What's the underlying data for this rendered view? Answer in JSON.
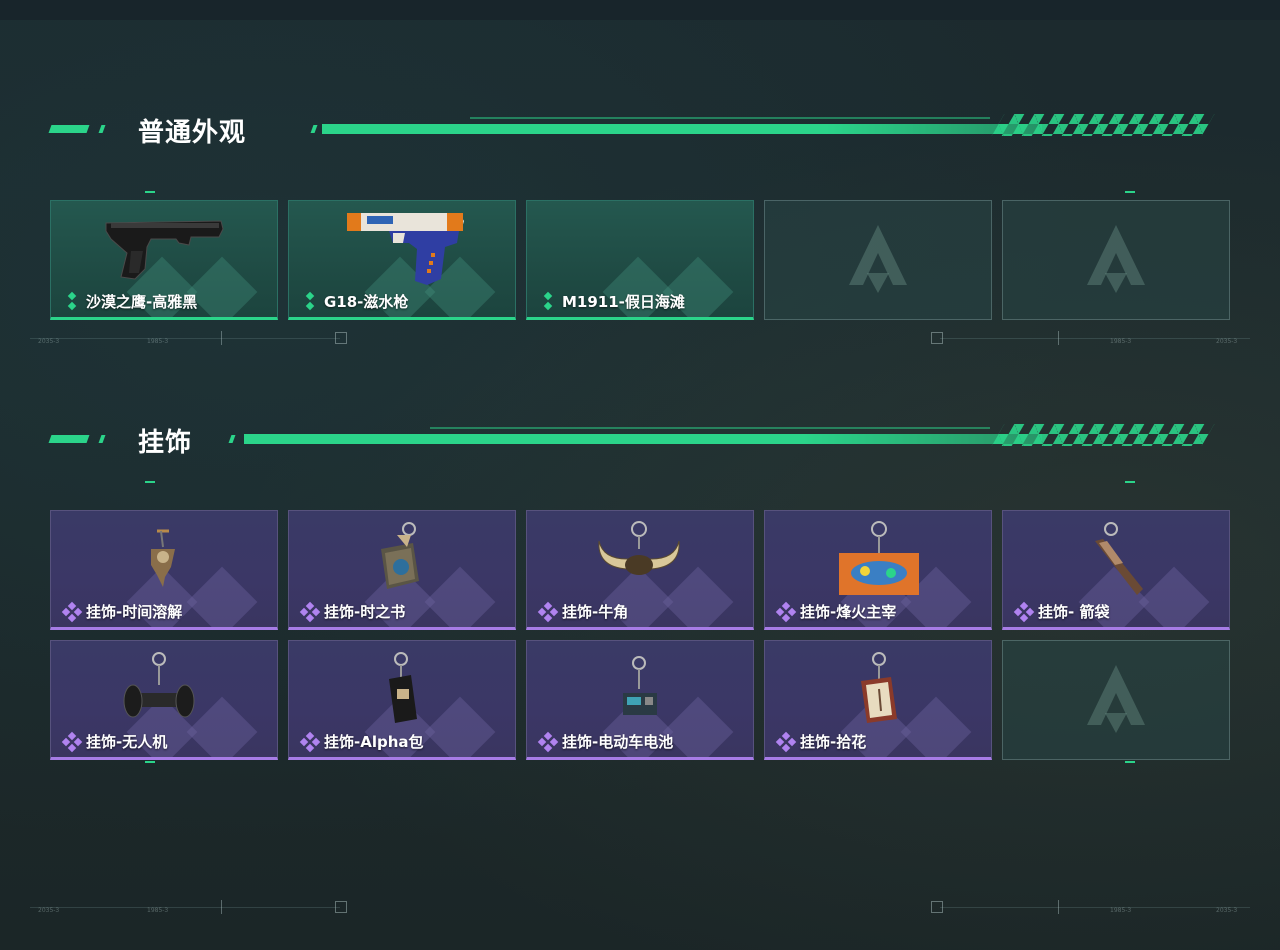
{
  "sections": {
    "skins": {
      "title": "普通外观",
      "items": [
        {
          "label": "沙漠之鹰-高雅黑",
          "icon": "pistol-black-icon"
        },
        {
          "label": "G18-滋水枪",
          "icon": "water-pistol-icon"
        },
        {
          "label": "M1911-假日海滩",
          "icon": ""
        }
      ]
    },
    "charms": {
      "title": "挂饰",
      "items": [
        {
          "label": "挂饰-时间溶解",
          "icon": "melting-clock-charm-icon"
        },
        {
          "label": "挂饰-时之书",
          "icon": "book-charm-icon"
        },
        {
          "label": "挂饰-牛角",
          "icon": "bull-horn-charm-icon"
        },
        {
          "label": "挂饰-烽火主宰",
          "icon": "banner-charm-icon"
        },
        {
          "label": "挂饰- 箭袋",
          "icon": "quiver-charm-icon"
        },
        {
          "label": "挂饰-无人机",
          "icon": "drone-charm-icon"
        },
        {
          "label": "挂饰-Alpha包",
          "icon": "alpha-bag-charm-icon"
        },
        {
          "label": "挂饰-电动车电池",
          "icon": "battery-charm-icon"
        },
        {
          "label": "挂饰-拾花",
          "icon": "flower-frame-charm-icon"
        }
      ]
    }
  },
  "guide_labels": {
    "left_top": "2035-3",
    "left_mid": "1985-3",
    "right_mid": "1985-3",
    "right_top": "2035-3"
  },
  "colors": {
    "accent_green": "#2bd48a",
    "rarity_purple": "#a77ce6",
    "background": "#1d2b2d"
  }
}
